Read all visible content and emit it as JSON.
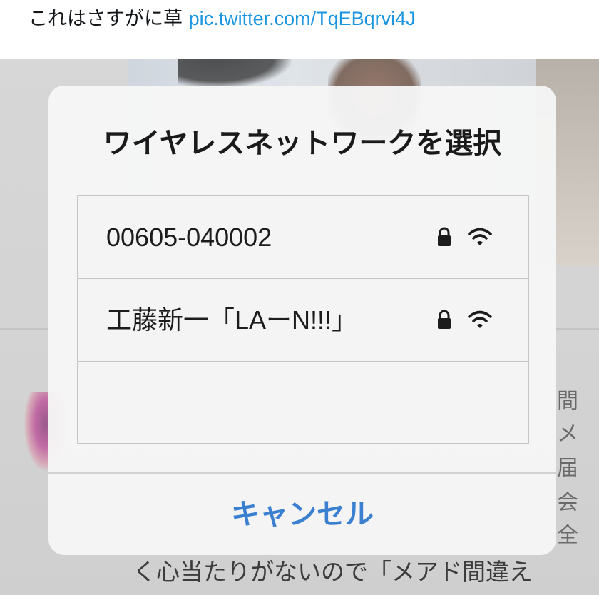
{
  "tweet": {
    "text": "これはさすがに草",
    "link": "pic.twitter.com/TqEBqrvi4J"
  },
  "dialog": {
    "title": "ワイヤレスネットワークを選択",
    "networks": [
      {
        "name": "00605-040002",
        "locked": true,
        "signal_bars": 3
      },
      {
        "name": "工藤新一「LAーN!!!」",
        "locked": true,
        "signal_bars": 3
      },
      {
        "name": ""
      }
    ],
    "cancel_label": "キャンセル"
  },
  "background_text": {
    "side_chars": [
      "間",
      "メ",
      "届",
      "会",
      "全"
    ],
    "bottom_line": "く心当たりがないので「メアド間違え"
  },
  "colors": {
    "link": "#1b95e0",
    "cancel": "#3a7fd0"
  }
}
